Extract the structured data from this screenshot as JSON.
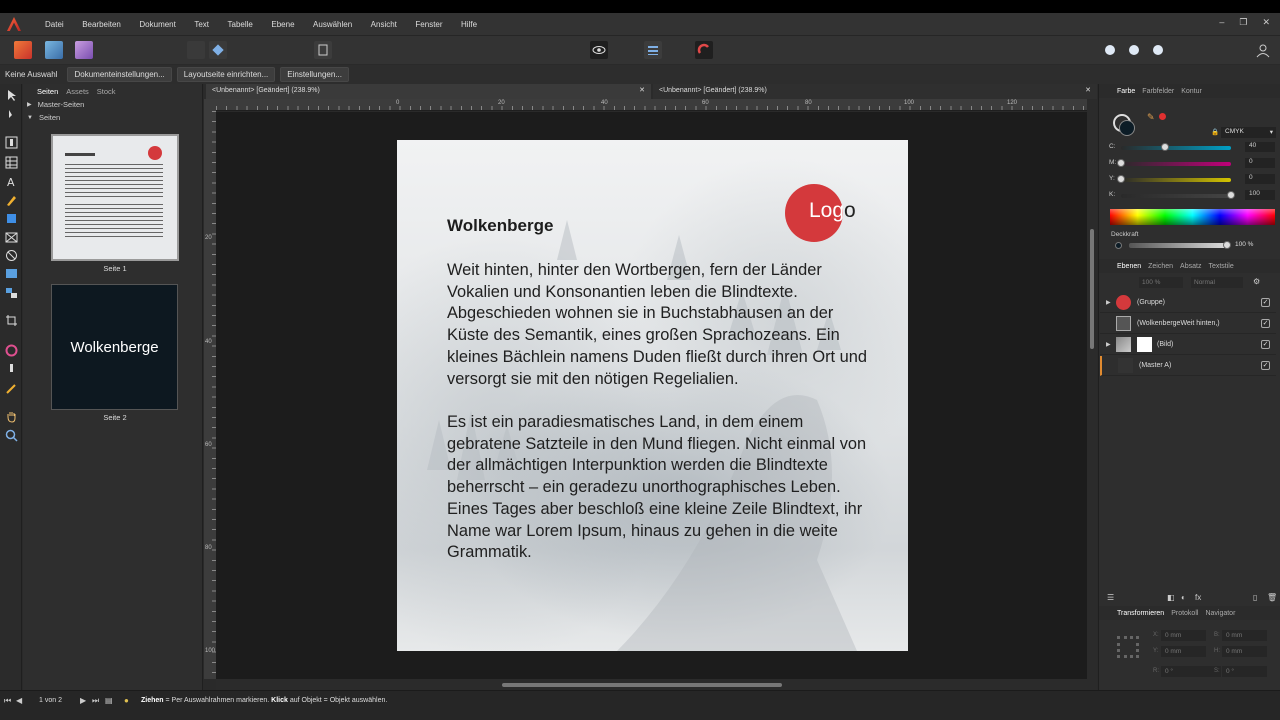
{
  "menu": [
    "Datei",
    "Bearbeiten",
    "Dokument",
    "Text",
    "Tabelle",
    "Ebene",
    "Auswählen",
    "Ansicht",
    "Fenster",
    "Hilfe"
  ],
  "context": {
    "selection": "Keine Auswahl",
    "buttons": [
      "Dokumenteinstellungen...",
      "Layoutseite einrichten...",
      "Einstellungen..."
    ]
  },
  "pages_panel": {
    "tabs": [
      "Seiten",
      "Assets",
      "Stock"
    ],
    "master_label": "Master-Seiten",
    "pages_label": "Seiten",
    "page1_label": "Seite 1",
    "page2_label": "Seite 2",
    "page2_title": "Wolkenberge"
  },
  "doc_tabs": [
    "<Unbenannt> [Geändert] (238.9%)",
    "<Unbenannt> [Geändert] (238.9%)"
  ],
  "ruler_h": [
    "0",
    "20",
    "40",
    "60",
    "80",
    "100",
    "120"
  ],
  "ruler_v": [
    "20",
    "40",
    "60",
    "80",
    "100"
  ],
  "page": {
    "title": "Wolkenberge",
    "paragraph1": "Weit hinten, hinter den Wortbergen, fern der Länder Vokalien und Konsonantien leben die Blindtexte. Abgeschieden wohnen sie in Buchstabhausen an der Küste des Semantik, eines großen Sprachozeans. Ein kleines Bächlein namens Duden fließt durch ihren Ort und versorgt sie mit den nötigen Regelialien.",
    "paragraph2": "Es ist ein paradiesmatisches Land, in dem einem gebratene Satzteile in den Mund fliegen. Nicht einmal von der allmächtigen Interpunktion werden die Blindtexte beherrscht – ein geradezu unorthographisches Leben. Eines Tages aber beschloß eine kleine Zeile Blindtext, ihr Name war Lorem Ipsum, hinaus zu gehen in die weite Grammatik.",
    "logo_light": "Log",
    "logo_dark": "o"
  },
  "color_panel": {
    "tabs": [
      "Farbe",
      "Farbfelder",
      "Kontur"
    ],
    "model": "CMYK",
    "channels": [
      {
        "label": "C:",
        "value": "40",
        "level": 0.4,
        "color": "#00a0c6"
      },
      {
        "label": "M:",
        "value": "0",
        "level": 0.0,
        "color": "#c0007a"
      },
      {
        "label": "Y:",
        "value": "0",
        "level": 0.0,
        "color": "#d4c400"
      },
      {
        "label": "K:",
        "value": "100",
        "level": 1.0,
        "color": "#444"
      }
    ],
    "opacity_label": "Deckkraft",
    "opacity_value": "100 %"
  },
  "layers_panel": {
    "tabs": [
      "Ebenen",
      "Zeichen",
      "Absatz",
      "Textstile"
    ],
    "opacity": "100 %",
    "blend": "Normal",
    "layers": [
      "(Gruppe)",
      "(WolkenbergeWeit hinten,)",
      "(Bild)",
      "(Master A)"
    ]
  },
  "transform_panel": {
    "tabs": [
      "Transformieren",
      "Protokoll",
      "Navigator"
    ],
    "fields": [
      "0 mm",
      "0 mm",
      "0 mm",
      "0 mm",
      "0 °",
      "0 °"
    ],
    "labels": [
      "X:",
      "Y:",
      "B:",
      "H:",
      "R:",
      "S:"
    ]
  },
  "status": {
    "page_nav": "1 von 2",
    "action1": "Ziehen",
    "text1": " = Per Auswahlrahmen markieren. ",
    "action2": "Klick",
    "text2": " auf Objekt = Objekt auswählen."
  }
}
